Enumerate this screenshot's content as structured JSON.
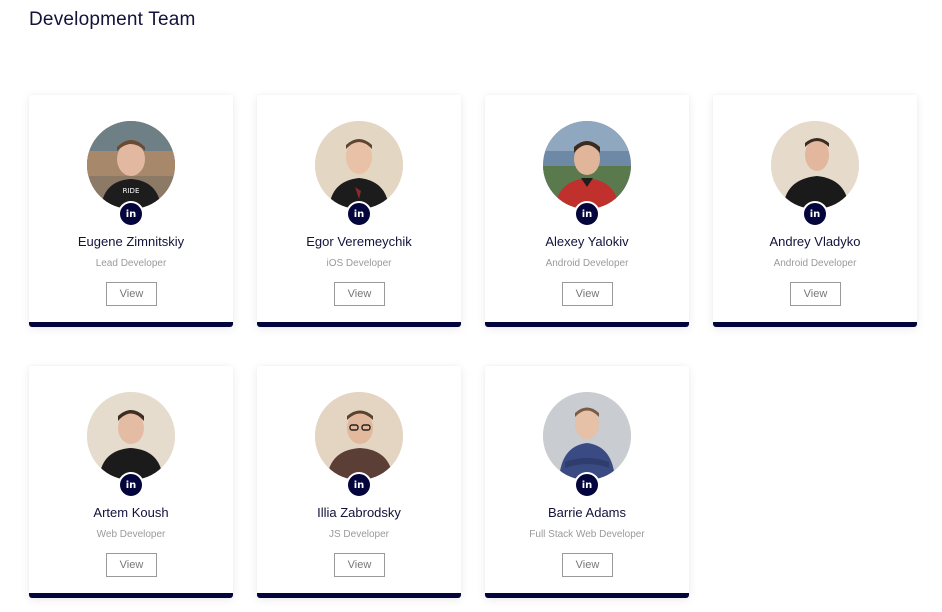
{
  "header": {
    "title": "Development Team"
  },
  "theme": {
    "accent": "#05053d",
    "muted": "#9a9a9a"
  },
  "team": [
    {
      "name": "Eugene Zimnitskiy",
      "role": "Lead Developer",
      "view_label": "View",
      "social_icon": "linkedin-icon",
      "social_label": "in"
    },
    {
      "name": "Egor Veremeychik",
      "role": "iOS Developer",
      "view_label": "View",
      "social_icon": "linkedin-icon",
      "social_label": "in"
    },
    {
      "name": "Alexey Yalokiv",
      "role": "Android Developer",
      "view_label": "View",
      "social_icon": "linkedin-icon",
      "social_label": "in"
    },
    {
      "name": "Andrey Vladyko",
      "role": "Android Developer",
      "view_label": "View",
      "social_icon": "linkedin-icon",
      "social_label": "in"
    },
    {
      "name": "Artem Koush",
      "role": "Web Developer",
      "view_label": "View",
      "social_icon": "linkedin-icon",
      "social_label": "in"
    },
    {
      "name": "Illia Zabrodsky",
      "role": "JS Developer",
      "view_label": "View",
      "social_icon": "linkedin-icon",
      "social_label": "in"
    },
    {
      "name": "Barrie Adams",
      "role": "Full Stack Web Developer",
      "view_label": "View",
      "social_icon": "linkedin-icon",
      "social_label": "in"
    }
  ]
}
